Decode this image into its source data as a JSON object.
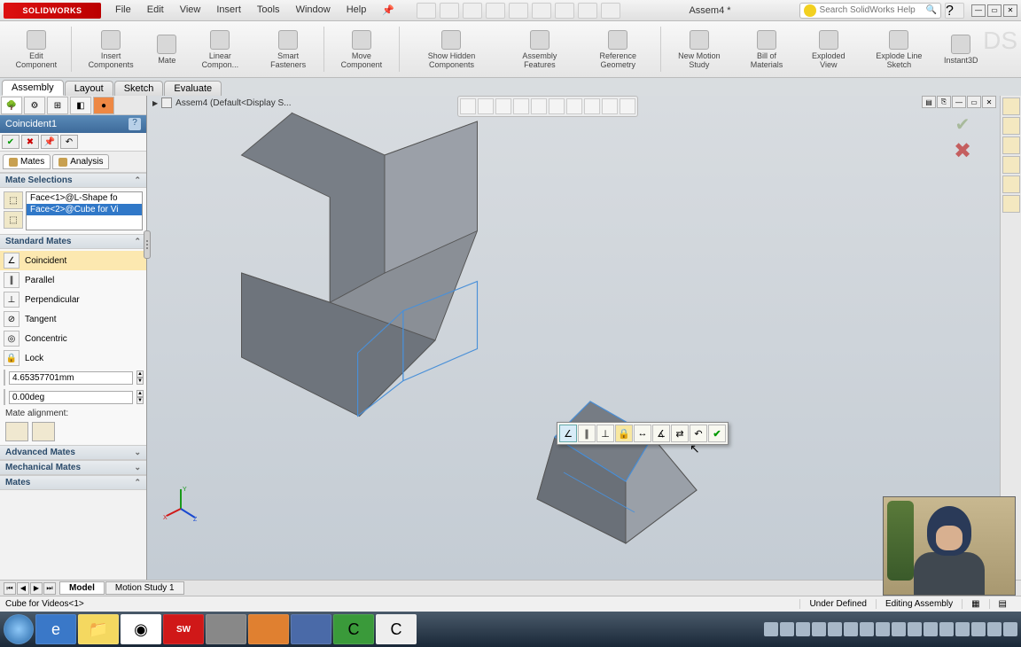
{
  "app": {
    "logo_text": "SOLIDWORKS",
    "doc_title": "Assem4 *"
  },
  "menu": [
    "File",
    "Edit",
    "View",
    "Insert",
    "Tools",
    "Window",
    "Help"
  ],
  "search": {
    "placeholder": "Search SolidWorks Help"
  },
  "ribbon_items": [
    {
      "label": "Edit Component"
    },
    {
      "label": "Insert Components"
    },
    {
      "label": "Mate"
    },
    {
      "label": "Linear Compon..."
    },
    {
      "label": "Smart Fasteners"
    },
    {
      "label": "Move Component"
    },
    {
      "label": "Show Hidden Components"
    },
    {
      "label": "Assembly Features"
    },
    {
      "label": "Reference Geometry"
    },
    {
      "label": "New Motion Study"
    },
    {
      "label": "Bill of Materials"
    },
    {
      "label": "Exploded View"
    },
    {
      "label": "Explode Line Sketch"
    },
    {
      "label": "Instant3D"
    }
  ],
  "tabs": {
    "items": [
      "Assembly",
      "Layout",
      "Sketch",
      "Evaluate"
    ],
    "active": 0
  },
  "pm": {
    "title": "Coincident1",
    "subtabs": {
      "mates": "Mates",
      "analysis": "Analysis"
    },
    "sections": {
      "selections_h": "Mate Selections",
      "standard_h": "Standard Mates",
      "advanced_h": "Advanced Mates",
      "mechanical_h": "Mechanical Mates",
      "mates_h": "Mates"
    },
    "selections": [
      "Face<1>@L-Shape fo",
      "Face<2>@Cube for Vi"
    ],
    "std_mates": [
      "Coincident",
      "Parallel",
      "Perpendicular",
      "Tangent",
      "Concentric",
      "Lock"
    ],
    "distance_value": "4.65357701mm",
    "angle_value": "0.00deg",
    "alignment_label": "Mate alignment:"
  },
  "breadcrumb": {
    "text": "Assem4  (Default<Display S..."
  },
  "bottom_tabs": {
    "items": [
      "Model",
      "Motion Study 1"
    ],
    "active": 0
  },
  "status": {
    "hint": "Cube for Videos<1>",
    "defined": "Under Defined",
    "mode": "Editing Assembly"
  },
  "colors": {
    "sel_blue": "#3078c8",
    "pm_header": "#3d6a9a"
  }
}
